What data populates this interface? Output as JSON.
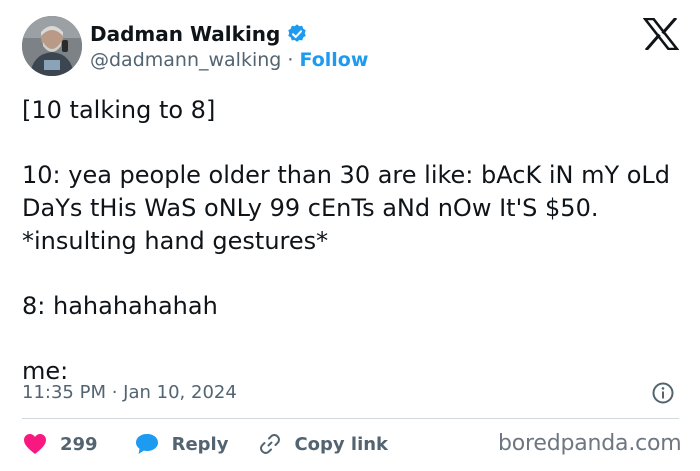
{
  "author": {
    "display_name": "Dadman Walking",
    "handle": "@dadmann_walking",
    "separator": "·",
    "follow_label": "Follow",
    "verified_icon": "verified-badge-icon",
    "verified_color": "#1d9bf0"
  },
  "platform_logo": "x-logo-icon",
  "tweet": {
    "lines": [
      "[10 talking to 8]",
      "10: yea people older than 30 are like: bAcK iN mY oLd DaYs tHis WaS oNLy 99 cEnTs aNd nOw It'S $50. *insulting hand gestures*",
      "8: hahahahahah",
      "me:"
    ]
  },
  "meta": {
    "time": "11:35 PM",
    "separator": "·",
    "date": "Jan 10, 2024",
    "info_icon": "info-icon"
  },
  "actions": {
    "like_count": "299",
    "like_icon": "heart-icon",
    "like_color": "#f91880",
    "reply_label": "Reply",
    "reply_icon": "speech-bubble-icon",
    "reply_color": "#1d9bf0",
    "copy_label": "Copy link",
    "copy_icon": "link-icon"
  },
  "watermark": "boredpanda.com"
}
